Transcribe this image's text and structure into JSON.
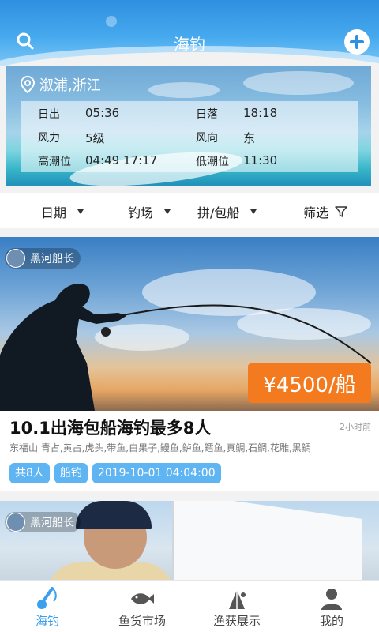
{
  "header": {
    "title": "海钓"
  },
  "weather": {
    "location": "溆浦,浙江",
    "rows": [
      {
        "label_a": "日出",
        "value_a": "05:36",
        "label_b": "日落",
        "value_b": "18:18"
      },
      {
        "label_a": "风力",
        "value_a": "5级",
        "label_b": "风向",
        "value_b": "东"
      },
      {
        "label_a": "高潮位",
        "value_a": "04:49 17:17",
        "label_b": "低潮位",
        "value_b": "11:30"
      }
    ]
  },
  "filters": {
    "date": "日期",
    "spot": "钓场",
    "boat": "拼/包船",
    "filter": "筛选"
  },
  "posts": [
    {
      "author": "黑河船长",
      "price": "¥4500/船",
      "title": "10.1出海包船海钓最多8人",
      "time": "2小时前",
      "species": "东福山 青占,黄占,虎头,带鱼,白果子,鳗鱼,鲈鱼,鳕鱼,真鲷,石鲷,花雕,黑鲷",
      "tags": [
        "共8人",
        "船钓",
        "2019-10-01 04:04:00"
      ]
    },
    {
      "author": "黑河船长"
    }
  ],
  "nav": [
    {
      "label": "海钓",
      "active": true,
      "icon": "fishing-rod-icon"
    },
    {
      "label": "鱼货市场",
      "active": false,
      "icon": "fish-icon"
    },
    {
      "label": "渔获展示",
      "active": false,
      "icon": "catch-icon"
    },
    {
      "label": "我的",
      "active": false,
      "icon": "user-icon"
    }
  ],
  "colors": {
    "accent": "#3aa0ee",
    "price": "#f47a1f",
    "tag": "#5fb4f2"
  }
}
